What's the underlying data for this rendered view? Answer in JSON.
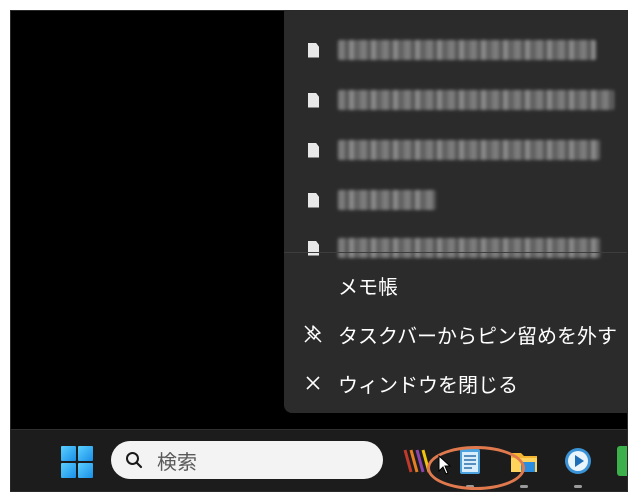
{
  "jumplist": {
    "app_name": "メモ帳",
    "unpin_label": "タスクバーからピン留めを外す",
    "close_label": "ウィンドウを閉じる",
    "recent_files_count": 5
  },
  "taskbar": {
    "search_placeholder": "検索",
    "pinned_apps": [
      "colorful-app-icon",
      "notepad-icon",
      "file-explorer-icon",
      "media-player-icon"
    ]
  },
  "colors": {
    "jumplist_bg": "#2b2b2b",
    "taskbar_bg": "#1c1c1c",
    "highlight_ring": "#e07a4e",
    "start_blue": "#1a8fe8"
  }
}
